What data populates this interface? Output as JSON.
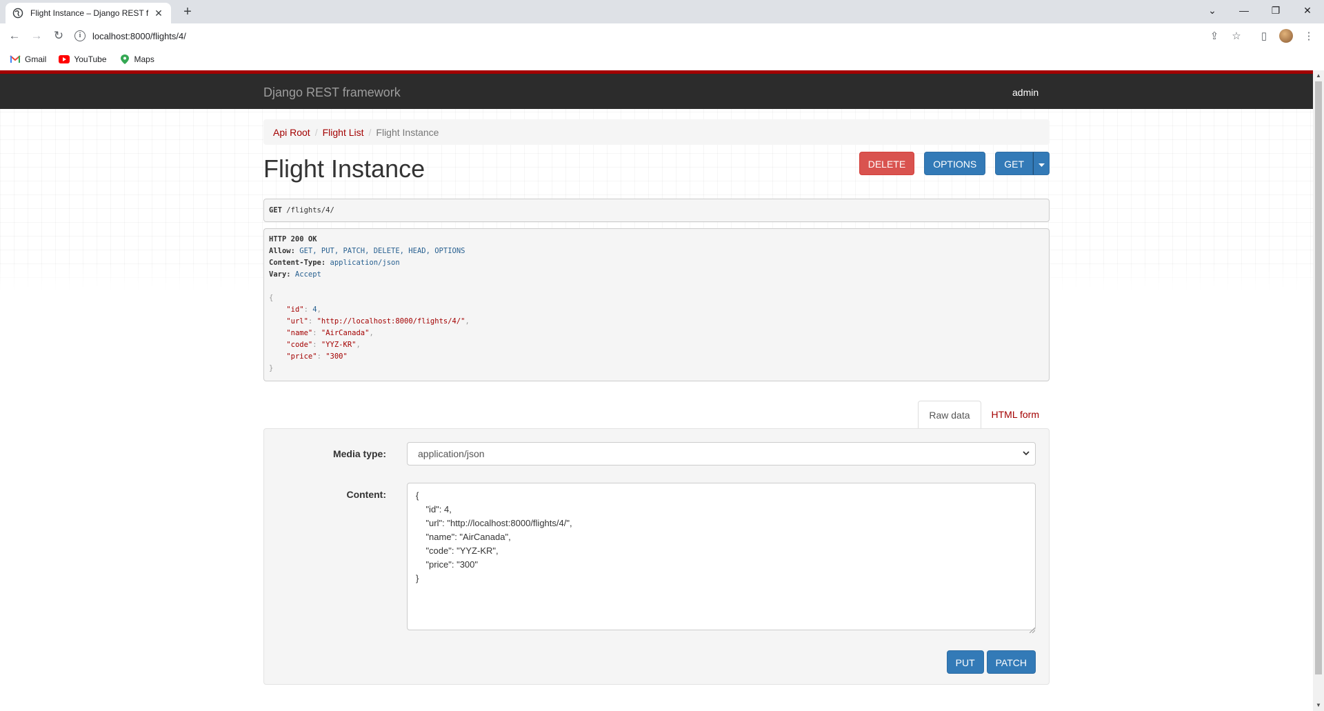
{
  "browser": {
    "tab_title": "Flight Instance – Django REST fra",
    "url": "localhost:8000/flights/4/",
    "bookmarks": [
      {
        "label": "Gmail",
        "icon": "gmail-icon"
      },
      {
        "label": "YouTube",
        "icon": "youtube-icon"
      },
      {
        "label": "Maps",
        "icon": "maps-icon"
      }
    ]
  },
  "navbar": {
    "brand": "Django REST framework",
    "user": "admin"
  },
  "breadcrumb": {
    "items": [
      "Api Root",
      "Flight List"
    ],
    "active": "Flight Instance"
  },
  "page": {
    "title": "Flight Instance",
    "buttons": {
      "delete": "DELETE",
      "options": "OPTIONS",
      "get": "GET"
    }
  },
  "request": {
    "method": "GET",
    "path": " /flights/4/"
  },
  "response": {
    "status": "HTTP 200 OK",
    "headers": [
      {
        "key": "Allow:",
        "value": " GET, PUT, PATCH, DELETE, HEAD, OPTIONS"
      },
      {
        "key": "Content-Type:",
        "value": " application/json"
      },
      {
        "key": "Vary:",
        "value": " Accept"
      }
    ],
    "body": {
      "open": "{",
      "fields": [
        {
          "key": "\"id\"",
          "value": "4",
          "type": "num",
          "comma": ","
        },
        {
          "key": "\"url\"",
          "value": "\"http://localhost:8000/flights/4/\"",
          "type": "str",
          "comma": ","
        },
        {
          "key": "\"name\"",
          "value": "\"AirCanada\"",
          "type": "str",
          "comma": ","
        },
        {
          "key": "\"code\"",
          "value": "\"YYZ-KR\"",
          "type": "str",
          "comma": ","
        },
        {
          "key": "\"price\"",
          "value": "\"300\"",
          "type": "str",
          "comma": ""
        }
      ],
      "close": "}"
    }
  },
  "form": {
    "tabs": {
      "raw": "Raw data",
      "html": "HTML form"
    },
    "media_type_label": "Media type:",
    "media_type_value": "application/json",
    "content_label": "Content:",
    "content_value": "{\n    \"id\": 4,\n    \"url\": \"http://localhost:8000/flights/4/\",\n    \"name\": \"AirCanada\",\n    \"code\": \"YYZ-KR\",\n    \"price\": \"300\"\n}",
    "put_label": "PUT",
    "patch_label": "PATCH"
  },
  "colors": {
    "brand_red": "#a30000",
    "navbar_bg": "#2c2c2c",
    "primary": "#337ab7",
    "danger": "#d9534f"
  }
}
